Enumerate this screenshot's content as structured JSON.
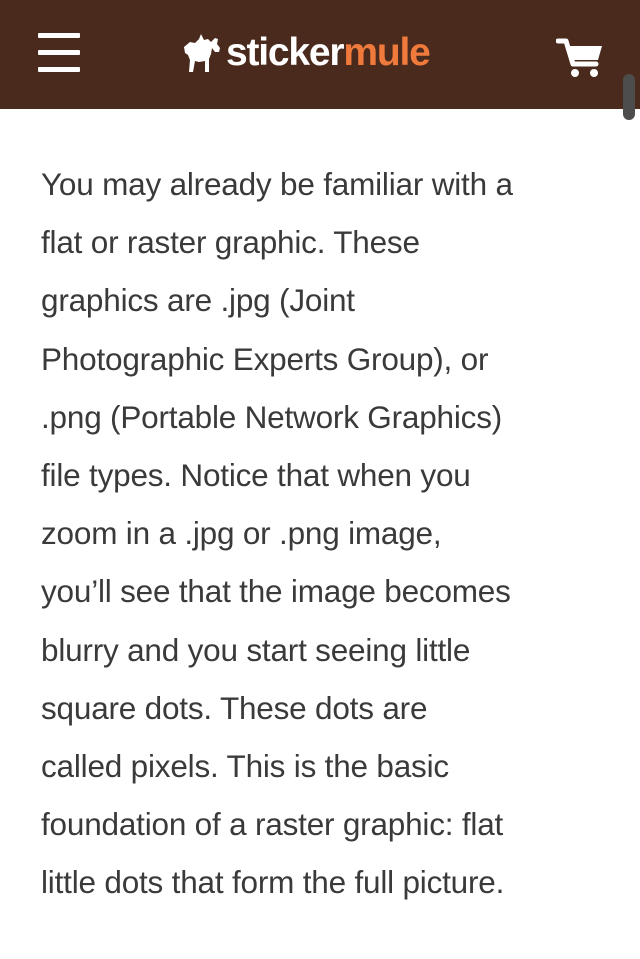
{
  "header": {
    "background_color": "#4a2a1c",
    "menu_icon": "hamburger-menu-icon",
    "logo": {
      "part1": "sticker",
      "part2": "mule",
      "part1_color": "#ffffff",
      "part2_color": "#f07a3c",
      "mascot_icon": "mule-icon"
    },
    "cart_icon": "shopping-cart-icon"
  },
  "content": {
    "text_color": "#3a3a3a",
    "lines": [
      "You may already be familiar with a",
      "flat or raster graphic. These",
      "graphics are .jpg (Joint",
      "Photographic Experts Group), or",
      ".png (Portable Network Graphics)",
      "file types. Notice that when you",
      "zoom in a .jpg or .png image,",
      "you’ll see that the image becomes",
      "blurry and you start seeing little",
      "square dots. These dots are",
      "called pixels. This is the basic",
      "foundation of a raster graphic: flat",
      "little dots that form the full picture."
    ]
  }
}
